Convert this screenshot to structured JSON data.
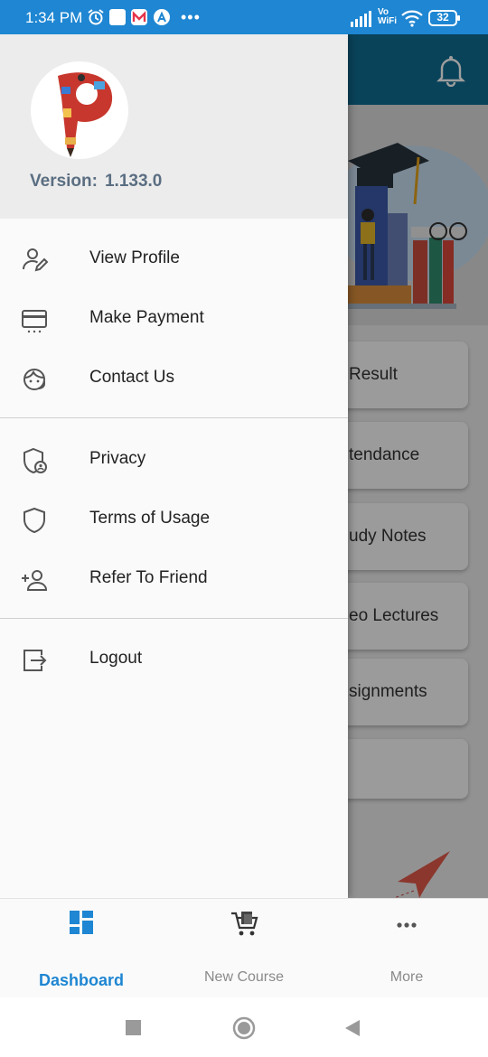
{
  "status_bar": {
    "time": "1:34 PM",
    "network_label_top": "Vo",
    "network_label_bottom": "WiFi",
    "battery": "32"
  },
  "background": {
    "cards": [
      {
        "label": "Result"
      },
      {
        "label": "tendance"
      },
      {
        "label": "udy Notes"
      },
      {
        "label": "eo Lectures"
      },
      {
        "label": "signments"
      },
      {
        "label": ""
      }
    ]
  },
  "drawer": {
    "version_label": "Version:",
    "version_number": "1.133.0",
    "items": [
      {
        "label": "View Profile",
        "icon": "user-edit-icon"
      },
      {
        "label": "Make Payment",
        "icon": "credit-card-icon"
      },
      {
        "label": "Contact Us",
        "icon": "support-agent-icon"
      },
      {
        "label": "Privacy",
        "icon": "privacy-shield-icon"
      },
      {
        "label": "Terms of Usage",
        "icon": "shield-icon"
      },
      {
        "label": "Refer To Friend",
        "icon": "add-user-icon"
      },
      {
        "label": "Logout",
        "icon": "logout-icon"
      }
    ]
  },
  "bottom_nav": {
    "tabs": [
      {
        "label": "Dashboard",
        "icon": "dashboard-icon",
        "active": true
      },
      {
        "label": "New Course",
        "icon": "cart-icon",
        "active": false
      },
      {
        "label": "More",
        "icon": "more-icon",
        "active": false
      }
    ]
  },
  "colors": {
    "accent": "#1e86d2",
    "header": "#0f6c91",
    "drawer_bg": "#fafafa",
    "drawer_header_bg": "#ececec"
  }
}
